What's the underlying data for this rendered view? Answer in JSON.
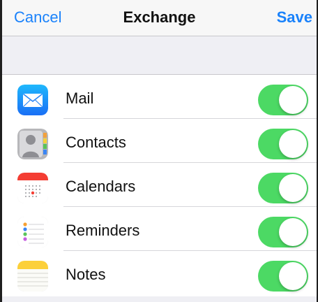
{
  "navbar": {
    "cancel_label": "Cancel",
    "title": "Exchange",
    "save_label": "Save"
  },
  "rows": [
    {
      "label": "Mail",
      "icon": "mail-icon",
      "enabled": true
    },
    {
      "label": "Contacts",
      "icon": "contacts-icon",
      "enabled": true
    },
    {
      "label": "Calendars",
      "icon": "calendars-icon",
      "enabled": true
    },
    {
      "label": "Reminders",
      "icon": "reminders-icon",
      "enabled": true
    },
    {
      "label": "Notes",
      "icon": "notes-icon",
      "enabled": true
    }
  ],
  "colors": {
    "accent": "#1a82fb",
    "toggle_on": "#4cd964",
    "background": "#efeff4"
  }
}
